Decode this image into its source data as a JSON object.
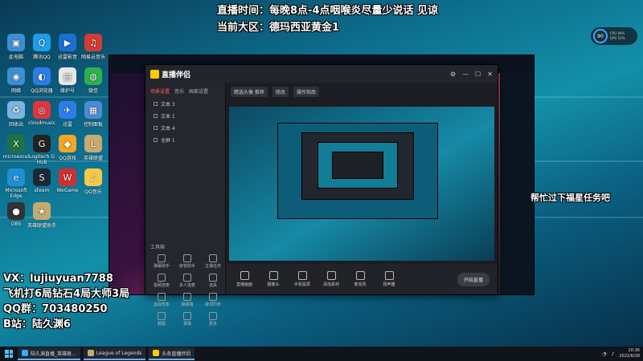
{
  "overlay": {
    "broadcast_line": "直播时间：每晚8点-4点咽喉炎尽量少说话 见谅",
    "region_line": "当前大区：德玛西亚黄金1",
    "right_message": "帮忙过下福星任务吧",
    "vx_line": "VX：lujiuyuan7788",
    "promo_line": "飞机打6局钻石4局大师3局",
    "qq_line": "QQ群：703480250",
    "bili_line": "B站：陆久渊6"
  },
  "desktop_icons": [
    {
      "id": "pc",
      "label": "此电脑",
      "glyph": "▣",
      "color": "#3a8fd6"
    },
    {
      "id": "tencent-qq",
      "label": "腾讯QQ",
      "glyph": "Q",
      "color": "#1aa0e8"
    },
    {
      "id": "xunlei",
      "label": "迅雷影音",
      "glyph": "▶",
      "color": "#1c6fd0"
    },
    {
      "id": "netease-music",
      "label": "网易云音乐",
      "glyph": "♫",
      "color": "#d43c33"
    },
    {
      "id": "network",
      "label": "网络",
      "glyph": "◉",
      "color": "#3a8fd6"
    },
    {
      "id": "qq-browser",
      "label": "QQ浏览器",
      "glyph": "◐",
      "color": "#2b7de9"
    },
    {
      "id": "maintenance",
      "label": "维护号",
      "glyph": "▤",
      "color": "#e8e8e8"
    },
    {
      "id": "wechat",
      "label": "微信",
      "glyph": "◍",
      "color": "#2bb24c"
    },
    {
      "id": "recycle",
      "label": "回收站",
      "glyph": "♻",
      "color": "#7ab6e0"
    },
    {
      "id": "cloudmusic",
      "label": "cloudmusic",
      "glyph": "◎",
      "color": "#e0363a"
    },
    {
      "id": "xunlei2",
      "label": "迅雷",
      "glyph": "✈",
      "color": "#2b7de9"
    },
    {
      "id": "control-panel",
      "label": "控制面板",
      "glyph": "▦",
      "color": "#4a8cd8"
    },
    {
      "id": "microexcel",
      "label": "microexcel",
      "glyph": "X",
      "color": "#1f7244"
    },
    {
      "id": "logitech",
      "label": "Logitech G HUB",
      "glyph": "G",
      "color": "#222222"
    },
    {
      "id": "qq-game",
      "label": "QQ游戏",
      "glyph": "◆",
      "color": "#f5a623"
    },
    {
      "id": "lol",
      "label": "英雄联盟",
      "glyph": "L",
      "color": "#c8aa6e"
    },
    {
      "id": "edge",
      "label": "Microsoft Edge",
      "glyph": "e",
      "color": "#1f8fd6"
    },
    {
      "id": "steam",
      "label": "steam",
      "glyph": "S",
      "color": "#1b2838"
    },
    {
      "id": "wegame",
      "label": "WeGame",
      "glyph": "W",
      "color": "#d32f2f"
    },
    {
      "id": "qq-music",
      "label": "QQ音乐",
      "glyph": "♪",
      "color": "#f7c948"
    },
    {
      "id": "obs",
      "label": "OBS",
      "glyph": "●",
      "color": "#333333"
    },
    {
      "id": "lol-tool",
      "label": "英雄联盟助手",
      "glyph": "★",
      "color": "#c8aa6e"
    }
  ],
  "app": {
    "title": "直播伴侣",
    "tabs": [
      "场景设置",
      "音乐",
      "画面设置"
    ],
    "scenes": [
      "文本 3",
      "文本 1",
      "文本 4",
      "全屏 1"
    ],
    "tools_label": "工具箱",
    "tools": [
      "弹幕助手",
      "房管助手",
      "主播任务",
      "视频连麦",
      "多人连麦",
      "道具",
      "虚拟形象",
      "弹幕墙",
      "歌词同步",
      "截图",
      "录像",
      "更多"
    ],
    "main_pills": [
      "精选头像 推荐",
      "修改",
      "操作指南"
    ],
    "controls": [
      "直播画面",
      "摄像头",
      "手机投屏",
      "添加素材",
      "麦克风",
      "扬声器"
    ],
    "start_button": "开始直播"
  },
  "taskbar": {
    "items": [
      {
        "label": "陆久渊直播_英雄联...",
        "color": "#3ea6ff"
      },
      {
        "label": "League of Legends",
        "color": "#c8aa6e"
      },
      {
        "label": "头条直播伴侣",
        "color": "#ffcc00"
      }
    ],
    "time": "20:36",
    "date": "2022/6/28"
  },
  "perf": {
    "value": "90",
    "line1": "CPU 46%",
    "line2": "GPU 52%"
  }
}
